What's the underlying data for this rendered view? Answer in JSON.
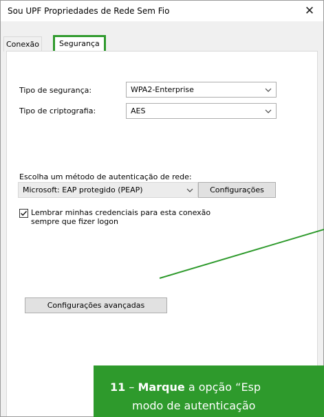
{
  "window": {
    "title": "Sou UPF Propriedades de Rede Sem Fio",
    "close_icon": "close-icon",
    "close_glyph": "✕"
  },
  "tabs": [
    {
      "label": "Conexão",
      "selected": false
    },
    {
      "label": "Segurança",
      "selected": true
    }
  ],
  "security": {
    "type_label": "Tipo de segurança:",
    "type_value": "WPA2-Enterprise",
    "encryption_label": "Tipo de criptografia:",
    "encryption_value": "AES"
  },
  "auth": {
    "method_label": "Escolha um método de autenticação de rede:",
    "method_value": "Microsoft: EAP protegido (PEAP)",
    "settings_button": "Configurações",
    "remember_checkbox_line1": "Lembrar minhas credenciais para esta conexão",
    "remember_checkbox_line2": "sempre que fizer logon",
    "remember_checked": true
  },
  "advanced_button": "Configurações avançadas",
  "callout": {
    "number": "11",
    "dash": " – ",
    "bold_word": "Marque",
    "line1_rest": " a opção “Esp",
    "line2": "modo de autenticação"
  },
  "colors": {
    "highlight": "#2e9a2c",
    "callout_bg": "#2e9a2c"
  },
  "icons": {
    "chevron": "chevron-down-icon",
    "check": "check-icon"
  }
}
